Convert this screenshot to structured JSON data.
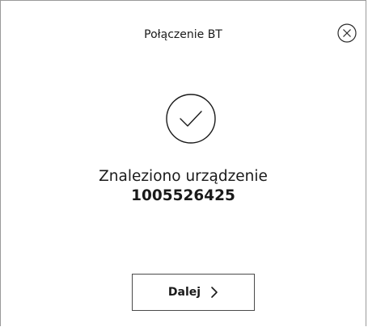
{
  "dialog": {
    "title": "Połączenie BT",
    "message": "Znaleziono urządzenie",
    "device_id": "1005526425",
    "next_label": "Dalej"
  },
  "icons": {
    "close": "close-circle-icon",
    "success": "checkmark-circle-icon",
    "next": "chevron-right-icon"
  },
  "colors": {
    "text": "#1a1a1a",
    "border": "#9a9a9a",
    "button_border": "#4a4a4a",
    "background": "#ffffff"
  }
}
